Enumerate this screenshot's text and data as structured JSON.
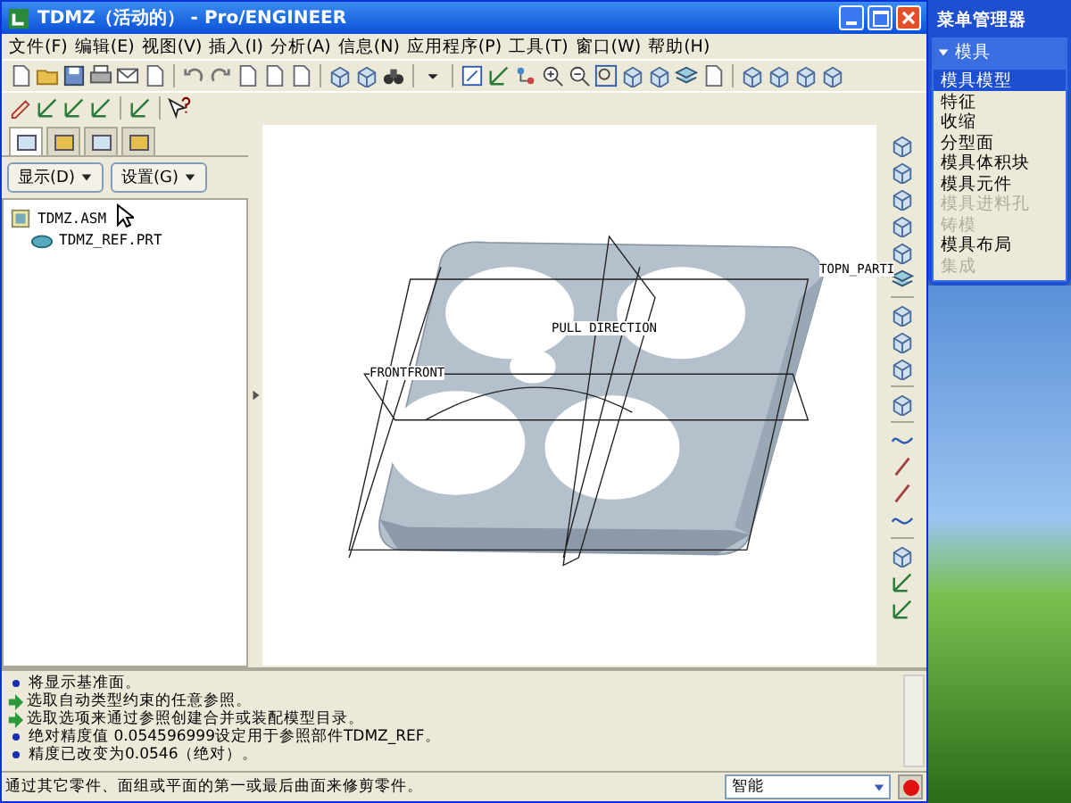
{
  "window": {
    "title": "TDMZ（活动的） - Pro/ENGINEER"
  },
  "menu_bar": [
    "文件(F)",
    "编辑(E)",
    "视图(V)",
    "插入(I)",
    "分析(A)",
    "信息(N)",
    "应用程序(P)",
    "工具(T)",
    "窗口(W)",
    "帮助(H)"
  ],
  "navigator": {
    "tabs": [
      {
        "selected": true
      },
      {
        "selected": false
      },
      {
        "selected": false
      },
      {
        "selected": false
      }
    ],
    "buttons": [
      "显示(D)",
      "设置(G)"
    ],
    "tree": [
      {
        "label": "TDMZ.ASM",
        "kind": "assembly",
        "children": [
          {
            "label": "TDMZ_REF.PRT",
            "kind": "part"
          }
        ]
      }
    ]
  },
  "graphics": {
    "labels": [
      "TOPN_PARTI",
      "PULL DIRECTION",
      "FRONTFRONT"
    ]
  },
  "messages": [
    {
      "kind": "info",
      "text": "将显示基准面。"
    },
    {
      "kind": "prompt",
      "text": "选取自动类型约束的任意参照。"
    },
    {
      "kind": "prompt",
      "text": "选取选项来通过参照创建合并或装配模型目录。"
    },
    {
      "kind": "info",
      "text": "绝对精度值 0.054596999设定用于参照部件TDMZ_REF。"
    },
    {
      "kind": "info",
      "text": "精度已改变为0.0546（绝对）。"
    }
  ],
  "status_bar": {
    "text": "通过其它零件、面组或平面的第一或最后曲面来修剪零件。",
    "filter": "智能"
  },
  "menu_manager": {
    "title": "菜单管理器",
    "section": "模具",
    "expanded": true,
    "items": [
      {
        "label": "模具模型",
        "selected": true,
        "disabled": false
      },
      {
        "label": "特征",
        "selected": false,
        "disabled": false
      },
      {
        "label": "收缩",
        "selected": false,
        "disabled": false
      },
      {
        "label": "分型面",
        "selected": false,
        "disabled": false
      },
      {
        "label": "模具体积块",
        "selected": false,
        "disabled": false
      },
      {
        "label": "模具元件",
        "selected": false,
        "disabled": false
      },
      {
        "label": "模具进料孔",
        "selected": false,
        "disabled": true
      },
      {
        "label": "铸模",
        "selected": false,
        "disabled": true
      },
      {
        "label": "模具布局",
        "selected": false,
        "disabled": false
      },
      {
        "label": "集成",
        "selected": false,
        "disabled": true
      }
    ]
  }
}
